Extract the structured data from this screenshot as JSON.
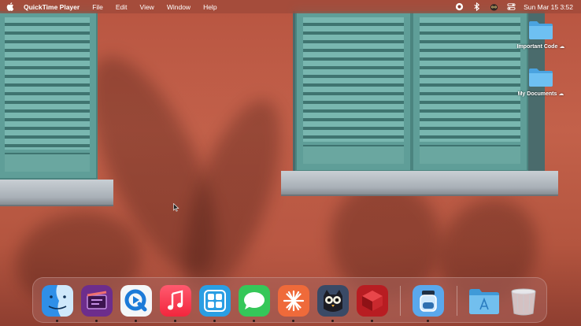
{
  "menubar": {
    "apple_icon": "apple-icon",
    "app_name": "QuickTime Player",
    "menus": [
      "File",
      "Edit",
      "View",
      "Window",
      "Help"
    ],
    "status_icons": [
      "record-icon",
      "bluetooth-icon",
      "owl-icon",
      "control-center-icon"
    ],
    "clock": "Sun Mar 15  3:52"
  },
  "desktop": {
    "icons": [
      {
        "name": "important-code",
        "label": "Important Code",
        "badge_icon": "icloud-icon",
        "badge": "☁"
      },
      {
        "name": "my-documents",
        "label": "My Documents",
        "badge_icon": "icloud-icon",
        "badge": "☁"
      }
    ]
  },
  "dock": {
    "apps": [
      {
        "name": "finder",
        "icon": "finder-icon",
        "running": true
      },
      {
        "name": "media-app",
        "icon": "clapper-icon",
        "running": true
      },
      {
        "name": "quicktime",
        "icon": "quicktime-icon",
        "running": true
      },
      {
        "name": "music",
        "icon": "music-icon",
        "running": true
      },
      {
        "name": "screens",
        "icon": "grid-icon",
        "running": true
      },
      {
        "name": "messages",
        "icon": "messages-icon",
        "running": true
      },
      {
        "name": "spark",
        "icon": "starburst-icon",
        "running": true
      },
      {
        "name": "night-owl",
        "icon": "owl-icon",
        "running": true
      },
      {
        "name": "red-app",
        "icon": "red-box-icon",
        "running": true
      },
      {
        "name": "jar-app",
        "icon": "jar-icon",
        "running": true
      },
      {
        "name": "applications-folder",
        "icon": "applications-folder-icon",
        "running": false
      },
      {
        "name": "trash",
        "icon": "trash-icon",
        "running": false
      }
    ]
  }
}
